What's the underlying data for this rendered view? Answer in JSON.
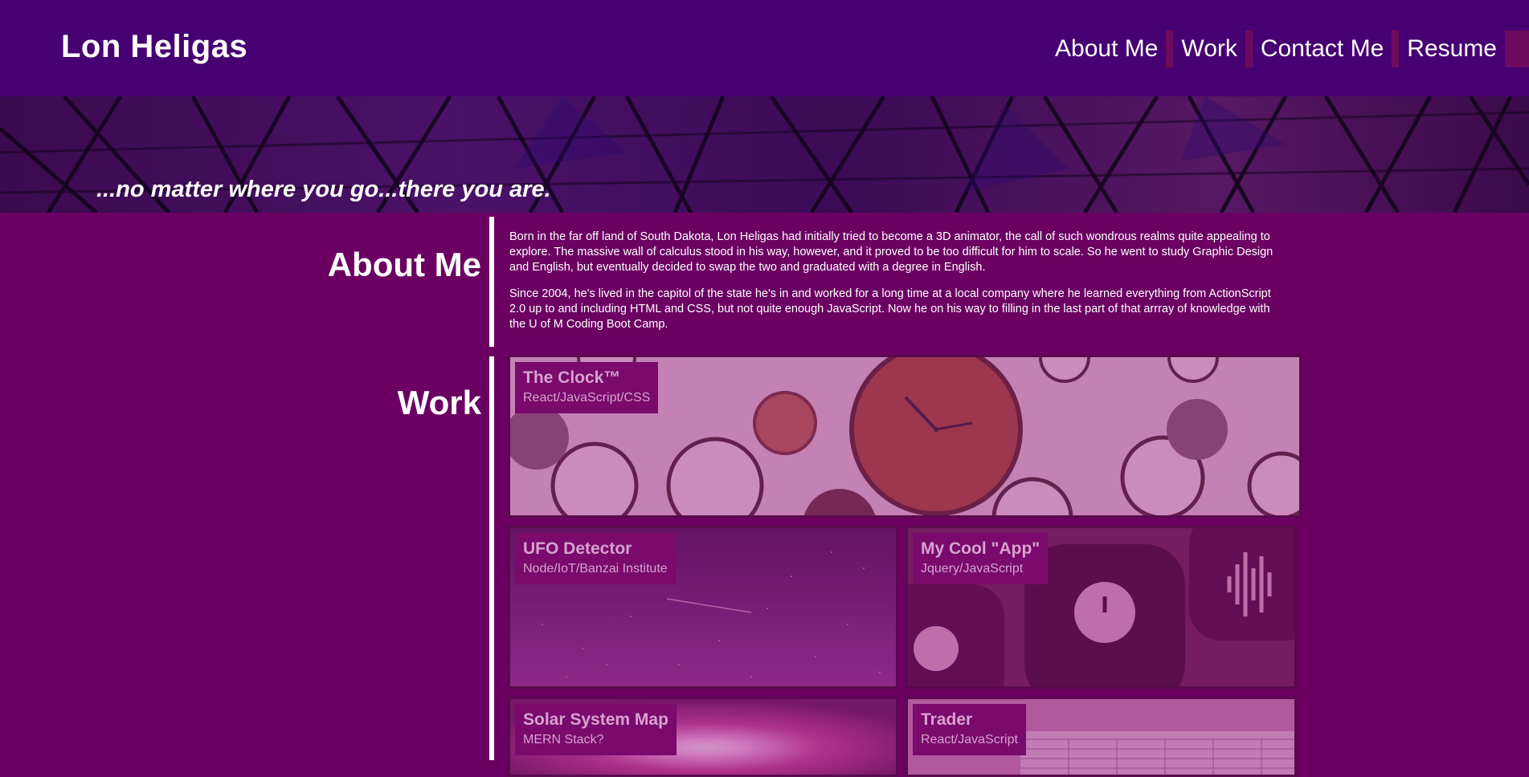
{
  "header": {
    "title": "Lon Heligas",
    "nav": [
      {
        "label": "About Me"
      },
      {
        "label": "Work"
      },
      {
        "label": "Contact Me"
      },
      {
        "label": "Resume"
      }
    ]
  },
  "hero": {
    "tagline": "...no matter where you go...there you are."
  },
  "about": {
    "heading": "About Me",
    "paragraphs": [
      "Born in the far off land of South Dakota, Lon Heligas had initially tried to become a 3D animator, the call of such wondrous realms quite appealing to explore. The massive wall of calculus stood in his way, however, and it proved to be too difficult for him to scale. So he went to study Graphic Design and English, but eventually decided to swap the two and graduated with a degree in English.",
      "Since 2004, he's lived in the capitol of the state he's in and worked for a long time at a local company where he learned everything from ActionScript 2.0 up to and including HTML and CSS, but not quite enough JavaScript. Now he on his way to filling in the last part of that arrray of knowledge with the U of M Coding Boot Camp."
    ]
  },
  "work": {
    "heading": "Work",
    "projects": [
      {
        "title": "The Clock™",
        "tech": "React/JavaScript/CSS",
        "image": "clocks-wall"
      },
      {
        "title": "UFO Detector",
        "tech": "Node/IoT/Banzai Institute",
        "image": "night-sky"
      },
      {
        "title": "My Cool \"App\"",
        "tech": "Jquery/JavaScript",
        "image": "app-icons"
      },
      {
        "title": "Solar System Map",
        "tech": "MERN Stack?",
        "image": "sun-flare"
      },
      {
        "title": "Trader",
        "tech": "React/JavaScript",
        "image": "stock-table"
      }
    ]
  },
  "colors": {
    "header_bg": "#470072",
    "page_bg": "#6b0062",
    "label_bg": "#7a0a6c",
    "label_text": "#d7a2cf"
  }
}
